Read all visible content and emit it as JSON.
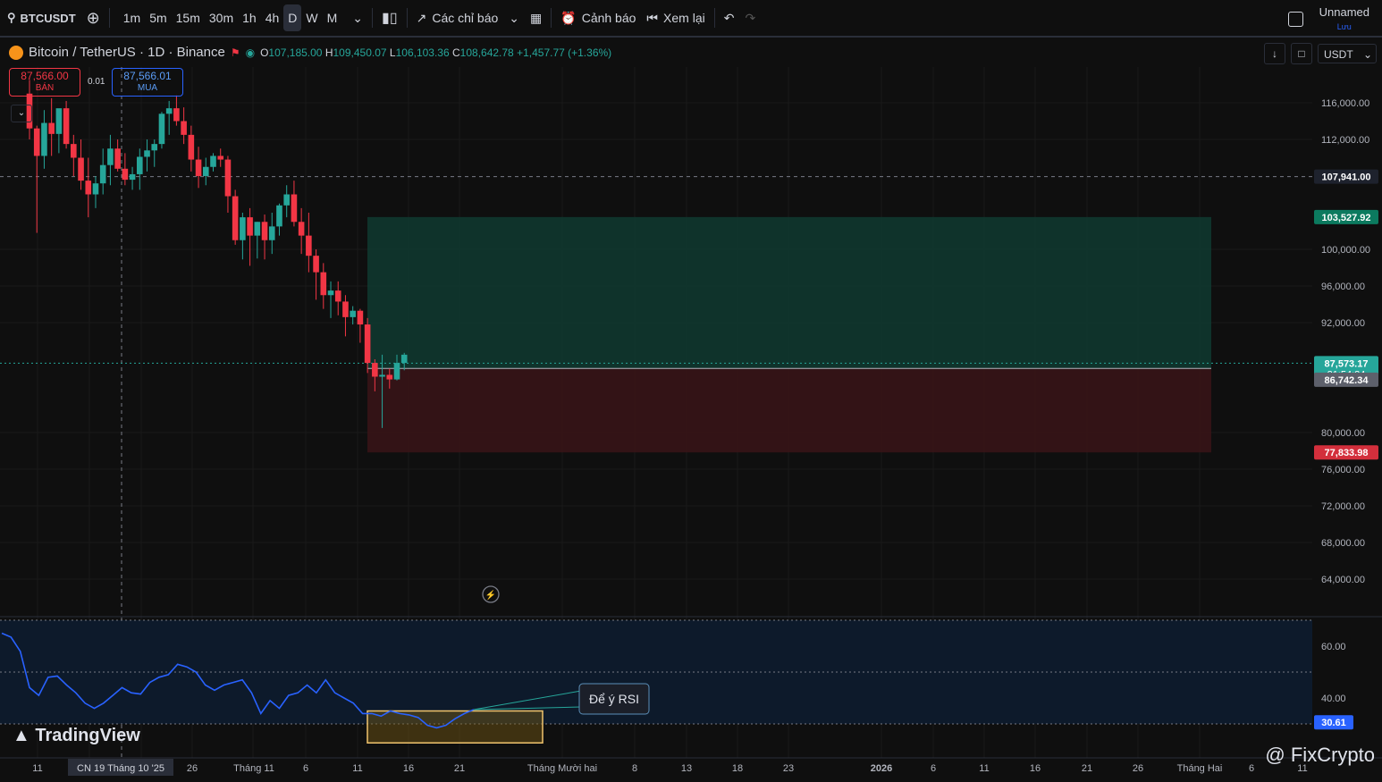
{
  "toolbar": {
    "symbol": "BTCUSDT",
    "timeframes": [
      "1m",
      "5m",
      "15m",
      "30m",
      "1h",
      "4h",
      "D",
      "W",
      "M"
    ],
    "active_timeframe": "D",
    "indicators_label": "Các chỉ báo",
    "alert_label": "Cảnh báo",
    "replay_label": "Xem lại",
    "layout_name": "Unnamed",
    "layout_sub": "Lưu"
  },
  "legend": {
    "title": "Bitcoin / TetherUS · 1D · Binance",
    "o_label": "O",
    "o": "107,185.00",
    "h_label": "H",
    "h": "109,450.07",
    "l_label": "L",
    "l": "106,103.36",
    "c_label": "C",
    "c": "108,642.78",
    "change": "+1,457.77 (+1.36%)"
  },
  "trade": {
    "sell_price": "87,566.00",
    "sell_label": "BÁN",
    "spread": "0.01",
    "buy_price": "87,566.01",
    "buy_label": "MUA"
  },
  "currency": "USDT",
  "colors": {
    "bg": "#0f0f0f",
    "up": "#26a69a",
    "down": "#f23645",
    "rsi": "#2962ff",
    "profit": "#0f3a30",
    "loss": "#3a1418",
    "highlight": "#f0c36d"
  },
  "annotation": "Để ý RSI",
  "branding": {
    "tradingview": "TradingView",
    "watermark": "@ FixCrypto"
  },
  "chart_data": [
    {
      "type": "candlestick",
      "title": "Bitcoin / TetherUS · 1D · Binance",
      "y_ticks": [
        "116,000.00",
        "112,000.00",
        "100,000.00",
        "96,000.00",
        "92,000.00",
        "80,000.00",
        "76,000.00",
        "72,000.00",
        "68,000.00",
        "64,000.00"
      ],
      "ylim": [
        60500,
        121000
      ],
      "x_ticks": [
        "11",
        "26",
        "Tháng 11",
        "6",
        "11",
        "16",
        "21",
        "Tháng Mười hai",
        "8",
        "13",
        "18",
        "23",
        "2026",
        "6",
        "11",
        "16",
        "21",
        "26",
        "Tháng Hai",
        "6",
        "11"
      ],
      "crosshair_x_label": "CN 19 Tháng 10 '25",
      "price_labels": [
        {
          "value": "107,941.00",
          "kind": "crosshair"
        },
        {
          "value": "103,527.92",
          "kind": "target"
        },
        {
          "value": "87,573.17",
          "kind": "last",
          "countdown": "21:54:24"
        },
        {
          "value": "86,742.34",
          "kind": "entry"
        },
        {
          "value": "77,833.98",
          "kind": "stop"
        }
      ],
      "position": {
        "entry": 87000,
        "target": 103527.92,
        "stop": 77833.98
      },
      "candles": [
        [
          117000,
          118500,
          112000,
          113200
        ],
        [
          113200,
          113500,
          101800,
          110200
        ],
        [
          110200,
          115200,
          108800,
          113800
        ],
        [
          113800,
          116500,
          110200,
          112600
        ],
        [
          112600,
          115000,
          110500,
          115400
        ],
        [
          115400,
          116200,
          111000,
          111500
        ],
        [
          111500,
          112500,
          108000,
          110000
        ],
        [
          110000,
          112000,
          106500,
          107500
        ],
        [
          107500,
          110000,
          103500,
          106000
        ],
        [
          106000,
          108000,
          104500,
          107200
        ],
        [
          107200,
          111000,
          106000,
          109200
        ],
        [
          109200,
          112500,
          107000,
          111000
        ],
        [
          111000,
          112000,
          108500,
          108800
        ],
        [
          108800,
          110500,
          107000,
          107600
        ],
        [
          107600,
          109000,
          106500,
          108200
        ],
        [
          108200,
          111000,
          106500,
          110100
        ],
        [
          110100,
          112000,
          108500,
          110800
        ],
        [
          110800,
          112000,
          109000,
          111500
        ],
        [
          111500,
          115000,
          111000,
          114800
        ],
        [
          114800,
          116200,
          112500,
          115400
        ],
        [
          115400,
          116800,
          113500,
          114000
        ],
        [
          114000,
          115500,
          111500,
          112500
        ],
        [
          112500,
          113500,
          108500,
          109800
        ],
        [
          109800,
          111200,
          106700,
          108000
        ],
        [
          108000,
          110000,
          107000,
          109000
        ],
        [
          109000,
          110500,
          108500,
          110200
        ],
        [
          110200,
          111000,
          109000,
          109800
        ],
        [
          109800,
          110200,
          104000,
          105800
        ],
        [
          105800,
          106500,
          100500,
          101000
        ],
        [
          101000,
          104000,
          98900,
          103500
        ],
        [
          103500,
          104500,
          98200,
          101500
        ],
        [
          101500,
          103000,
          99000,
          103000
        ],
        [
          103000,
          103800,
          98900,
          101000
        ],
        [
          101000,
          104000,
          99500,
          102500
        ],
        [
          102500,
          105000,
          101500,
          104800
        ],
        [
          104800,
          107000,
          103500,
          106000
        ],
        [
          106000,
          107500,
          102500,
          103000
        ],
        [
          103000,
          104500,
          99500,
          101500
        ],
        [
          101500,
          104000,
          97500,
          99300
        ],
        [
          99300,
          100000,
          94500,
          97500
        ],
        [
          97500,
          98500,
          93500,
          95000
        ],
        [
          95000,
          96500,
          92500,
          95500
        ],
        [
          95500,
          96500,
          92800,
          94300
        ],
        [
          94300,
          95000,
          90500,
          92600
        ],
        [
          92600,
          93800,
          91800,
          93300
        ],
        [
          93300,
          93500,
          89800,
          91800
        ],
        [
          91800,
          92500,
          86500,
          87600
        ],
        [
          87600,
          88000,
          84500,
          86100
        ],
        [
          86100,
          88500,
          80500,
          86300
        ],
        [
          86300,
          87000,
          84800,
          85800
        ],
        [
          85800,
          88500,
          85700,
          87600
        ],
        [
          87600,
          88700,
          86800,
          88500
        ]
      ]
    },
    {
      "type": "line",
      "series": [
        {
          "name": "RSI",
          "values": [
            65,
            63.5,
            58,
            44,
            41,
            48,
            48.5,
            45,
            42,
            38,
            36,
            38,
            41,
            44,
            42,
            41.5,
            46,
            48,
            49,
            53,
            52,
            50,
            45,
            43,
            45,
            46,
            47,
            42,
            34,
            39,
            36,
            41,
            42,
            45,
            42,
            47,
            42,
            40,
            38,
            34,
            34,
            33,
            35,
            34,
            33.5,
            32.5,
            29.5,
            28.5,
            29.5,
            32,
            34,
            35.5
          ]
        }
      ],
      "y_ticks": [
        "60.00",
        "40.00"
      ],
      "ylim": [
        29,
        70
      ],
      "bands": [
        30,
        50,
        70
      ],
      "value_label": "30.61",
      "highlight_range": [
        27.5,
        35
      ]
    }
  ]
}
